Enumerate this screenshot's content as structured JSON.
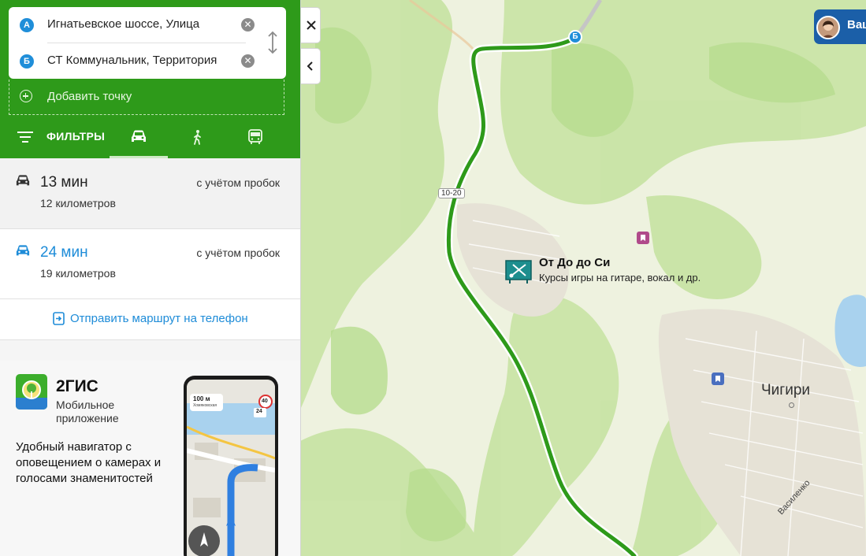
{
  "route": {
    "point_a": {
      "badge": "A",
      "value": "Игнатьевское шоссе, Улица"
    },
    "point_b": {
      "badge": "Б",
      "value": "СТ Коммунальник, Территория"
    },
    "add_point_label": "Добавить точку",
    "filters_label": "ФИЛЬТРЫ",
    "modes": [
      "car",
      "walk",
      "bus"
    ],
    "active_mode": "car"
  },
  "options": [
    {
      "time": "13 мин",
      "distance": "12 километров",
      "traffic_note": "с учётом пробок",
      "selected": true
    },
    {
      "time": "24 мин",
      "distance": "19 километров",
      "traffic_note": "с учётом пробок",
      "selected": false
    }
  ],
  "send_to_phone": "Отправить маршрут на телефон",
  "ad": {
    "app_name": "2ГИС",
    "subtitle": "Мобильное приложение",
    "description": "Удобный навигатор с оповещением о камерах и голосами знаменитостей",
    "phone": {
      "distance": "100 м",
      "street": "Хомяковская",
      "speed_limit": "40",
      "speed": "24"
    }
  },
  "map": {
    "road_number": "10-20",
    "point_b_badge": "Б",
    "place": {
      "title": "От До до Си",
      "subtitle": "Курсы игры на гитаре, вокал и др."
    },
    "city": "Чигири",
    "street": "Василенко",
    "user_name_partial": "Ваш",
    "colors": {
      "route": "#2e9a1a",
      "accent": "#1e8cd8",
      "panel_header": "#2e9a1a"
    }
  }
}
